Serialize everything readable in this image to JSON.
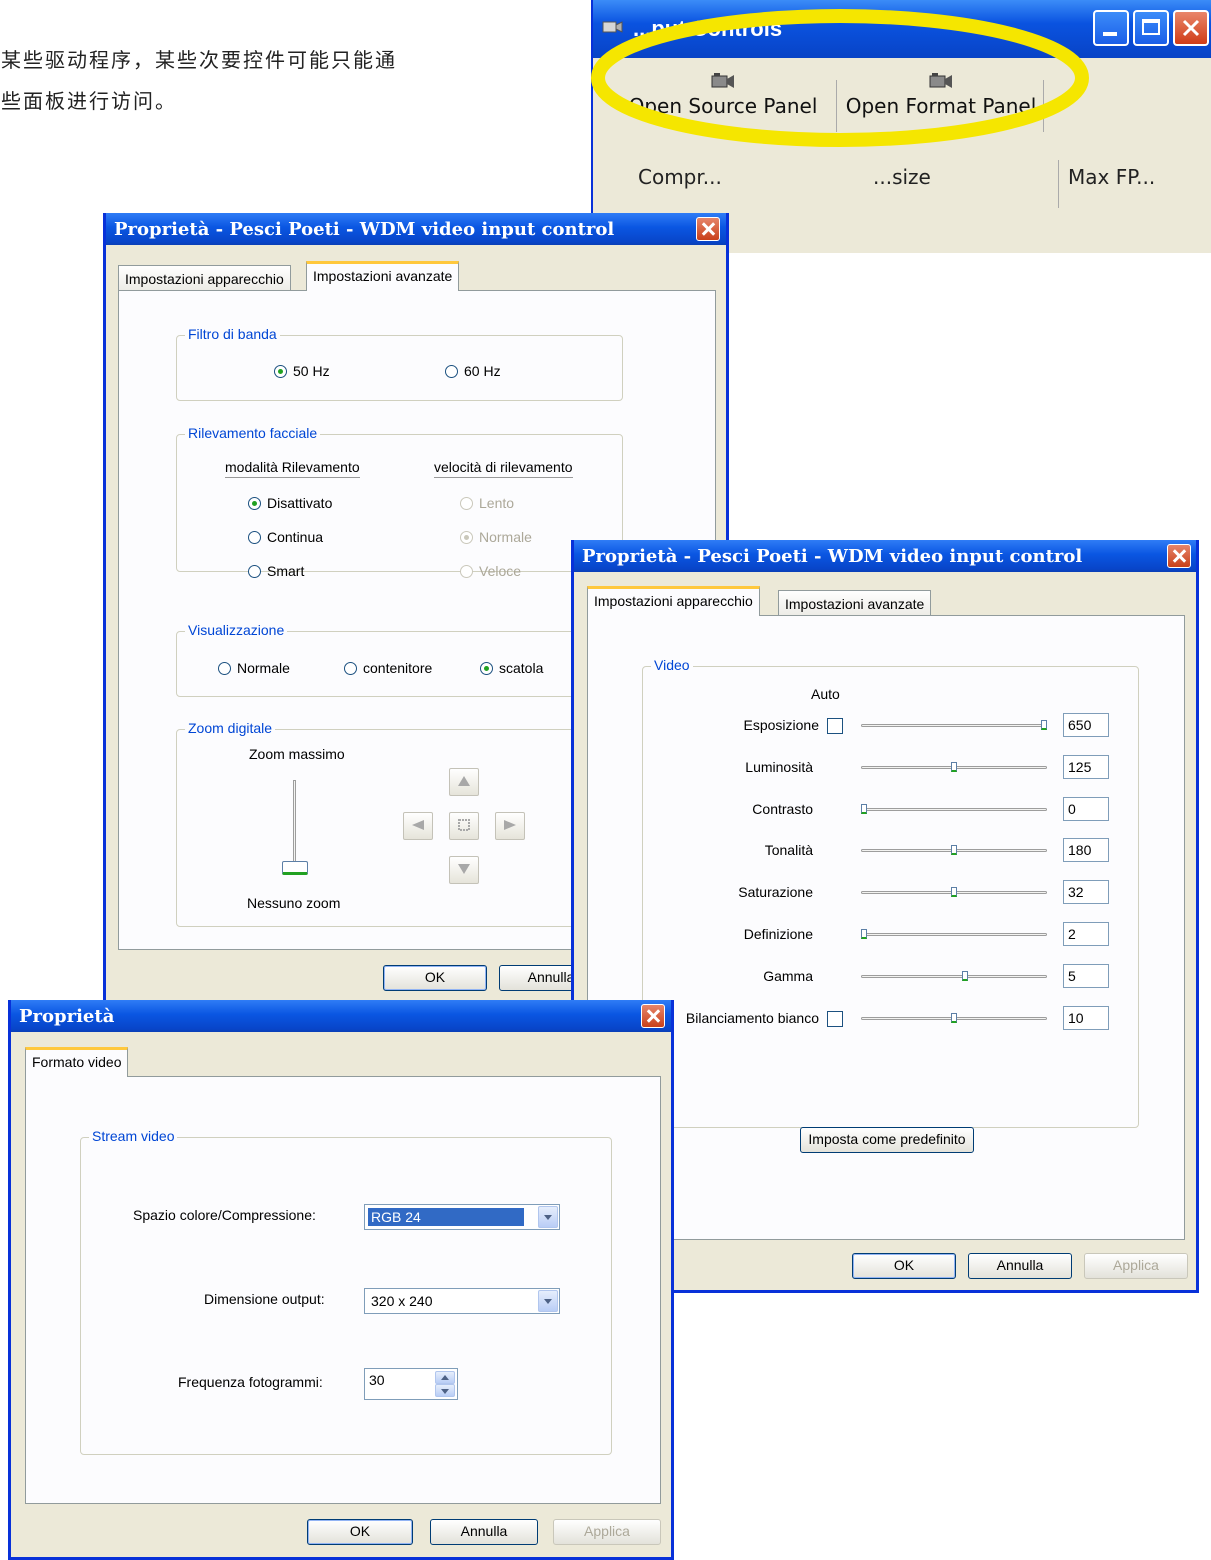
{
  "caption": {
    "line1": "于某些驱动程序，某些次要控件可能只能通",
    "line2": "这些面板进行访问。"
  },
  "video_input_controls": {
    "title": "Video Input Controls",
    "title_visible": "...put Controls",
    "toolbar": {
      "open_source_label": "Open Source Panel",
      "open_format_label": "Open Format Panel"
    },
    "columns": {
      "compression": "Compr...",
      "size": "...size",
      "max_fps": "Max FP..."
    },
    "highlight_color": "#F5E600"
  },
  "advanced_dialog": {
    "title": "Proprietà - Pesci Poeti - WDM video input control",
    "tabs": [
      "Impostazioni apparecchio",
      "Impostazioni avanzate"
    ],
    "active_tab": "Impostazioni avanzate",
    "band_filter": {
      "label": "Filtro di banda",
      "options": [
        "50 Hz",
        "60 Hz"
      ],
      "selected": "50 Hz"
    },
    "face_detection": {
      "label": "Rilevamento facciale",
      "mode_header": "modalità Rilevamento",
      "speed_header": "velocità di rilevamento",
      "modes": [
        "Disattivato",
        "Continua",
        "Smart"
      ],
      "mode_selected": "Disattivato",
      "speeds": [
        "Lento",
        "Normale",
        "Veloce"
      ],
      "speed_selected": "Normale"
    },
    "display": {
      "label": "Visualizzazione",
      "options": [
        "Normale",
        "contenitore",
        "scatola"
      ],
      "selected": "scatola"
    },
    "digital_zoom": {
      "label": "Zoom digitale",
      "max_label": "Zoom massimo",
      "min_label": "Nessuno zoom",
      "level": 0
    },
    "buttons": {
      "ok": "OK",
      "cancel": "Annulla"
    }
  },
  "device_dialog": {
    "title": "Proprietà - Pesci Poeti - WDM video input control",
    "tabs": [
      "Impostazioni apparecchio",
      "Impostazioni avanzate"
    ],
    "active_tab": "Impostazioni apparecchio",
    "group_label": "Video",
    "auto_label": "Auto",
    "settings": [
      {
        "label": "Esposizione",
        "value": "650",
        "auto": false,
        "has_auto": true,
        "position": 1.0
      },
      {
        "label": "Luminosità",
        "value": "125",
        "has_auto": false,
        "position": 0.5
      },
      {
        "label": "Contrasto",
        "value": "0",
        "has_auto": false,
        "position": 0.0
      },
      {
        "label": "Tonalità",
        "value": "180",
        "has_auto": false,
        "position": 0.5
      },
      {
        "label": "Saturazione",
        "value": "32",
        "has_auto": false,
        "position": 0.5
      },
      {
        "label": "Definizione",
        "value": "2",
        "has_auto": false,
        "position": 0.0
      },
      {
        "label": "Gamma",
        "value": "5",
        "has_auto": false,
        "position": 0.56
      },
      {
        "label": "Bilanciamento bianco",
        "value": "10",
        "auto": false,
        "has_auto": true,
        "position": 0.5
      }
    ],
    "default_button": "Imposta come predefinito",
    "buttons": {
      "ok": "OK",
      "cancel": "Annulla",
      "apply": "Applica"
    }
  },
  "format_dialog": {
    "title": "Proprietà",
    "tab": "Formato video",
    "group_label": "Stream video",
    "color_space_label": "Spazio colore/Compressione:",
    "color_space_value": "RGB 24",
    "output_size_label": "Dimensione output:",
    "output_size_value": "320 x 240",
    "frame_rate_label": "Frequenza fotogrammi:",
    "frame_rate_value": "30",
    "buttons": {
      "ok": "OK",
      "cancel": "Annulla",
      "apply": "Applica"
    }
  }
}
